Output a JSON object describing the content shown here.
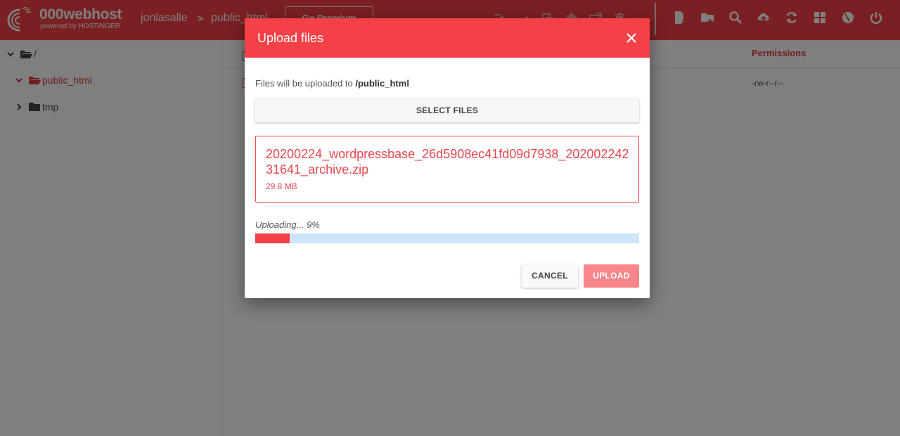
{
  "header": {
    "logo_text": "000webhost",
    "logo_sub": "powered by HOSTINGER",
    "breadcrumb_user": "jonlasalle",
    "breadcrumb_sep": ">",
    "breadcrumb_dir": "public_html",
    "go_premium": "Go Premium",
    "brand_color": "#f44147"
  },
  "tree": {
    "root": "/",
    "items": [
      {
        "label": "public_html",
        "expanded": true,
        "active": true
      },
      {
        "label": "tmp",
        "expanded": false,
        "active": false
      }
    ]
  },
  "table": {
    "permissions_header": "Permissions",
    "rows": [
      {
        "permissions": "-rw-r--r--"
      }
    ]
  },
  "dialog": {
    "title": "Upload files",
    "info_prefix": "Files will be uploaded to",
    "info_path": "/public_html",
    "select_files": "SELECT FILES",
    "file_name": "20200224_wordpressbase_26d5908ec41fd09d7938_20200224231641_archive.zip",
    "file_size": "29.8 MB",
    "status": "Uploading... 9%",
    "progress_percent": 9,
    "cancel": "CANCEL",
    "upload": "UPLOAD"
  }
}
